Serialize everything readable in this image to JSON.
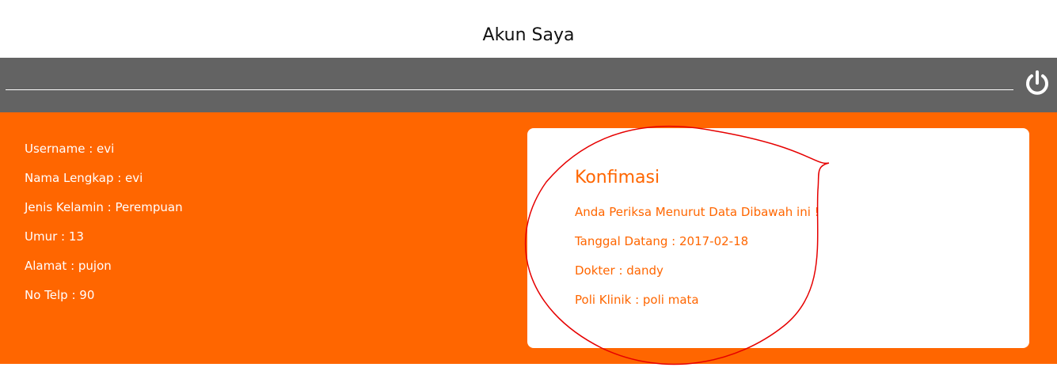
{
  "header": {
    "title": "Akun Saya"
  },
  "toolbar": {
    "logout_icon": "power-icon"
  },
  "profile": {
    "rows": [
      "Username : evi",
      "Nama Lengkap : evi",
      "Jenis Kelamin : Perempuan",
      "Umur : 13",
      "Alamat : pujon",
      "No Telp : 90"
    ]
  },
  "confirmation": {
    "title": "Konfimasi",
    "lines": [
      "Anda Periksa Menurut Data Dibawah ini !",
      "Tanggal Datang : 2017-02-18",
      "Dokter : dandy",
      "Poli Klinik : poli mata"
    ]
  },
  "colors": {
    "accent": "#ff6600",
    "toolbar": "#636363",
    "annotation": "#e60000"
  }
}
